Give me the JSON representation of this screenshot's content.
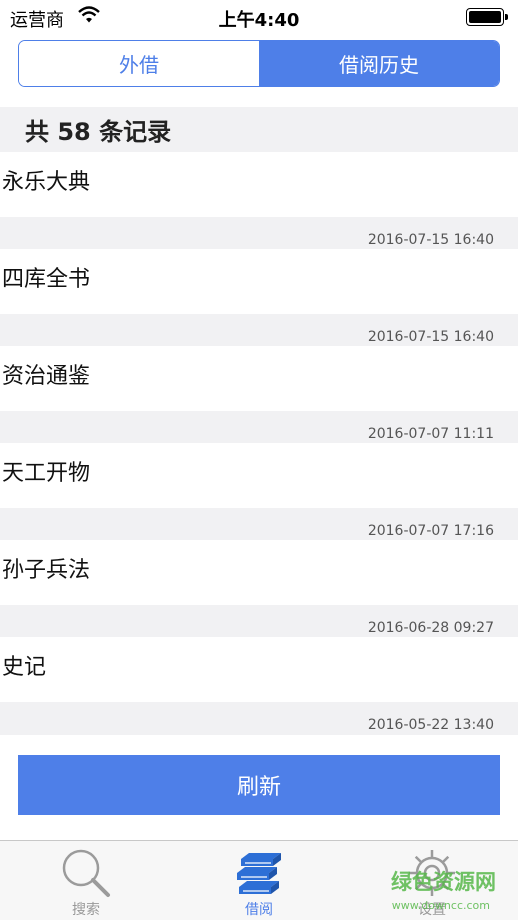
{
  "status_bar": {
    "carrier": "运营商",
    "time": "上午4:40"
  },
  "segmented_control": {
    "tabs": [
      "外借",
      "借阅历史"
    ],
    "selected": "借阅历史"
  },
  "list": {
    "count_text": "共 58 条记录",
    "records": [
      {
        "title": "永乐大典",
        "date": "2016-07-15 16:40"
      },
      {
        "title": "四库全书",
        "date": "2016-07-15 16:40"
      },
      {
        "title": "资治通鉴",
        "date": "2016-07-07 11:11"
      },
      {
        "title": "天工开物",
        "date": "2016-07-07 17:16"
      },
      {
        "title": "孙子兵法",
        "date": "2016-06-28 09:27"
      },
      {
        "title": "史记",
        "date": "2016-05-22 13:40"
      }
    ]
  },
  "refresh_label": "刷新",
  "tab_bar": {
    "items": [
      {
        "label": "搜索",
        "icon": "search-icon"
      },
      {
        "label": "借阅",
        "icon": "books-icon"
      },
      {
        "label": "设置",
        "icon": "gear-icon"
      }
    ],
    "active": "借阅"
  },
  "watermark": {
    "text": "绿色资源网",
    "sub": "www.downcc.com"
  },
  "colors": {
    "accent": "#4e7fe8",
    "list_background": "#f1f1f3",
    "watermark": "#57b84a"
  }
}
